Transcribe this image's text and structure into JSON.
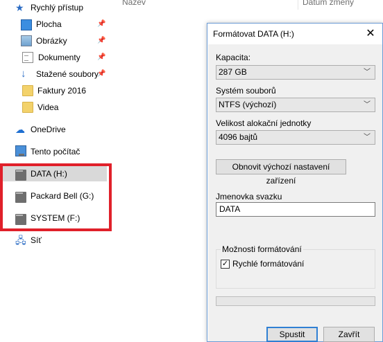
{
  "nav": {
    "quick_access": "Rychlý přístup",
    "items": [
      {
        "label": "Plocha",
        "icon": "desktop-icon",
        "pinned": true
      },
      {
        "label": "Obrázky",
        "icon": "pictures-icon",
        "pinned": true
      },
      {
        "label": "Dokumenty",
        "icon": "documents-icon",
        "pinned": true
      },
      {
        "label": "Stažené soubory",
        "icon": "download-icon",
        "pinned": true
      },
      {
        "label": "Faktury 2016",
        "icon": "folder-icon",
        "pinned": false
      },
      {
        "label": "Videa",
        "icon": "folder-icon",
        "pinned": false
      }
    ],
    "onedrive": "OneDrive",
    "this_pc": "Tento počítač",
    "drives": [
      {
        "label": "DATA (H:)",
        "selected": true
      },
      {
        "label": "Packard Bell (G:)",
        "selected": false
      },
      {
        "label": "SYSTEM (F:)",
        "selected": false
      }
    ],
    "network": "Síť"
  },
  "columns": {
    "name": "Název",
    "date": "Datum změny"
  },
  "dialog": {
    "title": "Formátovat DATA (H:)",
    "capacity_label": "Kapacita:",
    "capacity_value": "287 GB",
    "filesystem_label": "Systém souborů",
    "filesystem_value": "NTFS (výchozí)",
    "alloc_label": "Velikost alokační jednotky",
    "alloc_value": "4096 bajtů",
    "restore_button": "Obnovit výchozí nastavení zařízení",
    "volume_label": "Jmenovka svazku",
    "volume_value": "DATA",
    "options_label": "Možnosti formátování",
    "quick_format_label": "Rychlé formátování",
    "quick_format_checked": true,
    "progress": 0,
    "start_button": "Spustit",
    "close_button": "Zavřít"
  },
  "colors": {
    "highlight_box": "#e0202a",
    "selected_bg": "#d9d9d9",
    "primary_button_border": "#2f7fd3"
  }
}
